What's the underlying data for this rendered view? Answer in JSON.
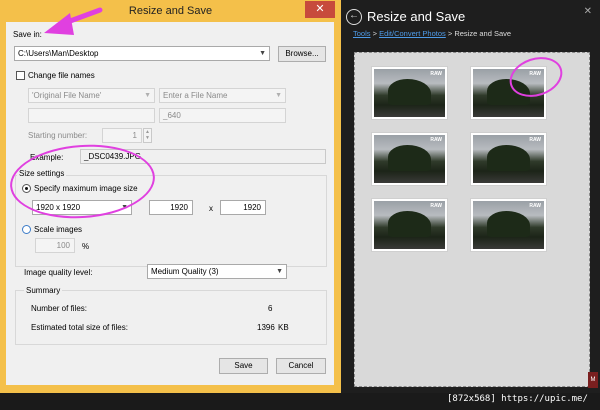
{
  "dialog": {
    "title": "Resize and Save",
    "close": "✕",
    "save_in_label": "Save in:",
    "path_value": "C:\\Users\\Man\\Desktop",
    "browse": "Browse...",
    "change_names_label": "Change file names",
    "name_select_1": "'Original File Name'",
    "name_select_2": "Enter a File Name",
    "suffix_value": "_640",
    "starting_number_label": "Starting number:",
    "starting_number_value": "1",
    "example_label": "Example:",
    "example_value": "_DSC0439.JPG",
    "size_settings_label": "Size settings",
    "specify_max_label": "Specify maximum image size",
    "preset_value": "1920 x 1920",
    "width_value": "1920",
    "times": "x",
    "height_value": "1920",
    "scale_label": "Scale images",
    "scale_value": "100",
    "percent": "%",
    "quality_label": "Image quality level:",
    "quality_value": "Medium Quality (3)",
    "summary_label": "Summary",
    "num_files_label": "Number of files:",
    "num_files_value": "6",
    "total_size_label": "Estimated total size of files:",
    "total_size_value": "1396",
    "total_size_unit": "KB",
    "save": "Save",
    "cancel": "Cancel"
  },
  "panel": {
    "back_icon": "back-arrow-icon",
    "title": "Resize and Save",
    "close": "✕",
    "crumb_1": "Tools",
    "crumb_sep_1": " > ",
    "crumb_2": "Edit/Convert Photos",
    "crumb_sep_2": " > ",
    "crumb_3": "Resize and Save",
    "raw_badge": "RAW",
    "thumbnail_count": 6
  },
  "watermark": {
    "text": "[872x568] https://upic.me/",
    "logo": "M"
  },
  "colors": {
    "dialog_frame": "#f4c04a",
    "annotation": "#e040e0",
    "link": "#4e9be8",
    "panel_bg": "#1e1e1e"
  }
}
